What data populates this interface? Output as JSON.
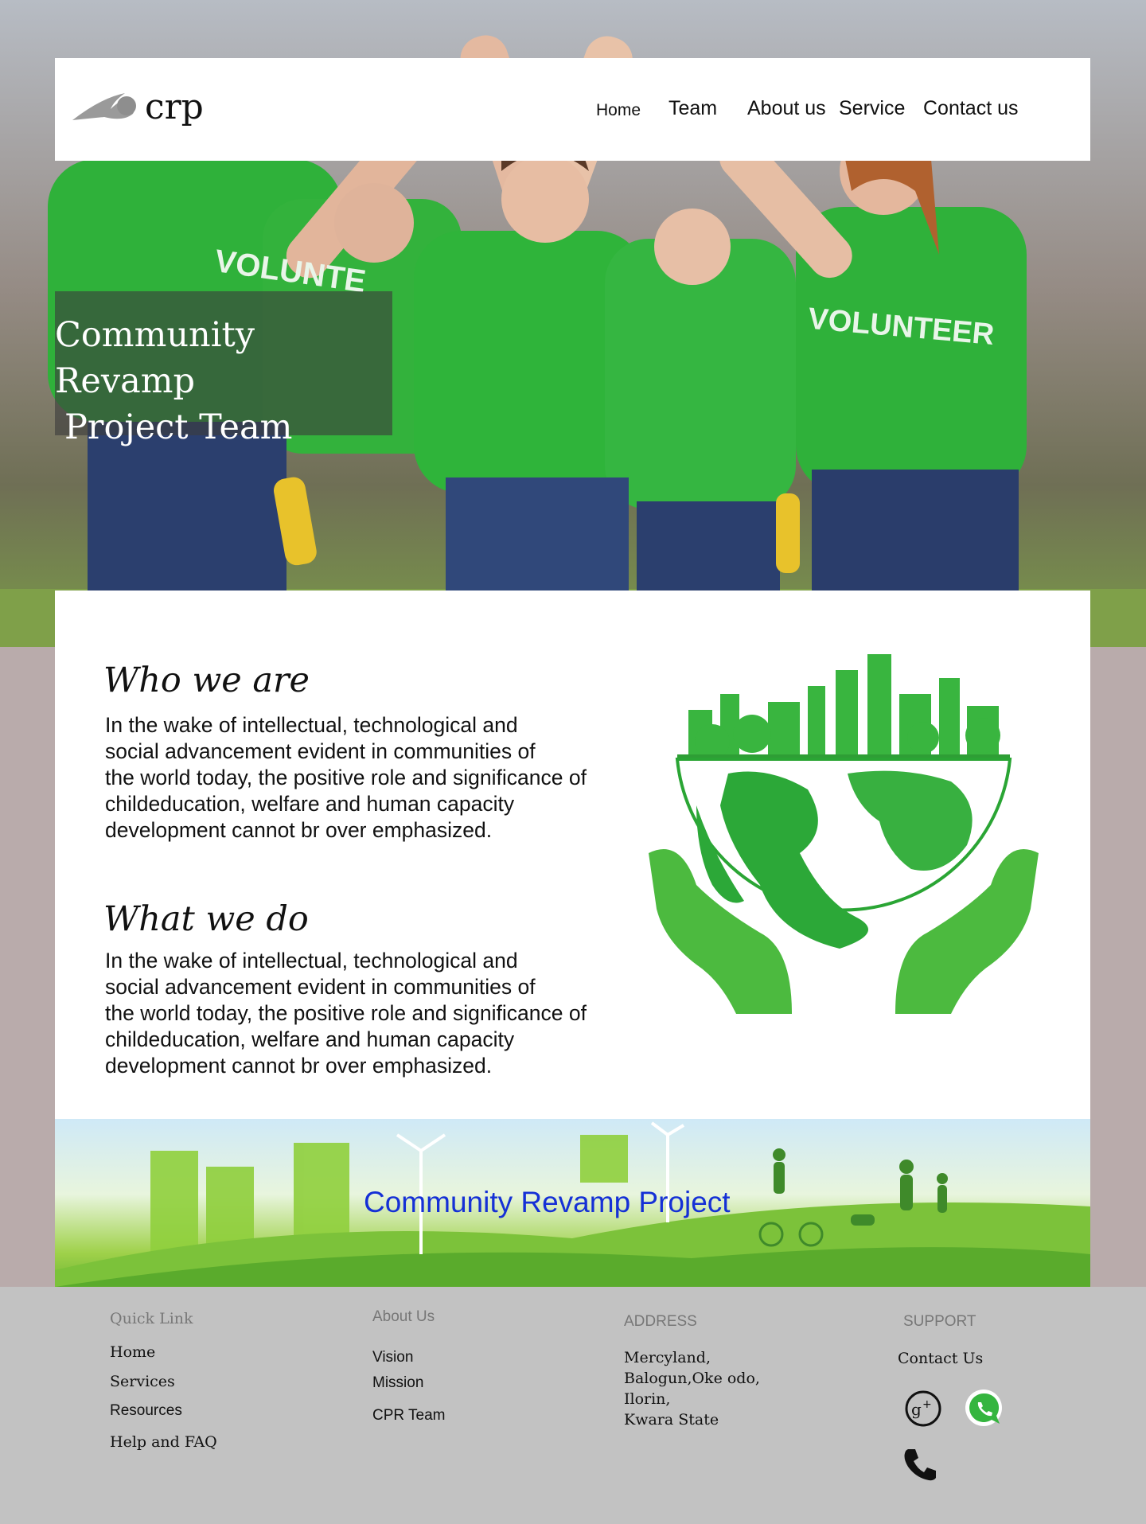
{
  "header": {
    "logo_text": "crp",
    "nav": [
      {
        "label": "Home"
      },
      {
        "label": "Team"
      },
      {
        "label": "About us"
      },
      {
        "label": "Service"
      },
      {
        "label": "Contact us"
      }
    ]
  },
  "hero": {
    "title_line1": "Community Revamp",
    "title_line2": "Project Team",
    "shirt_text": "VOLUNTEER",
    "shirt_text_partial": "VOLUNTE"
  },
  "who_we_are": {
    "heading": "Who we are",
    "body": "In the wake of intellectual, technological and\nsocial  advancement evident in communities of\nthe world today, the positive role and significance of\nchildeducation, welfare and human capacity\ndevelopment cannot br over emphasized."
  },
  "what_we_do": {
    "heading": "What we do",
    "body": "In the wake of intellectual, technological and\nsocial  advancement evident in communities of\nthe world today, the positive role and significance of\nchildeducation, welfare and human capacity\ndevelopment cannot br over emphasized."
  },
  "banner": {
    "title": "Community Revamp Project"
  },
  "footer": {
    "quick_link": {
      "heading": "Quick Link",
      "links": [
        "Home",
        "Services",
        "Resources",
        "Help and FAQ"
      ]
    },
    "about_us": {
      "heading": "About Us",
      "links": [
        "Vision",
        "Mission",
        "CPR Team"
      ]
    },
    "address": {
      "heading": "ADDRESS",
      "lines": [
        "Mercyland,",
        "Balogun,Oke odo,",
        "Ilorin,",
        "Kwara State"
      ]
    },
    "support": {
      "heading": "SUPPORT",
      "contact_label": "Contact Us",
      "icons": [
        "google-plus-icon",
        "whatsapp-icon",
        "phone-icon"
      ]
    }
  },
  "colors": {
    "page_bg": "#b9abab",
    "footer_bg": "#c2c2c2",
    "brand_green": "#2fb13a",
    "banner_title": "#1530d6"
  }
}
